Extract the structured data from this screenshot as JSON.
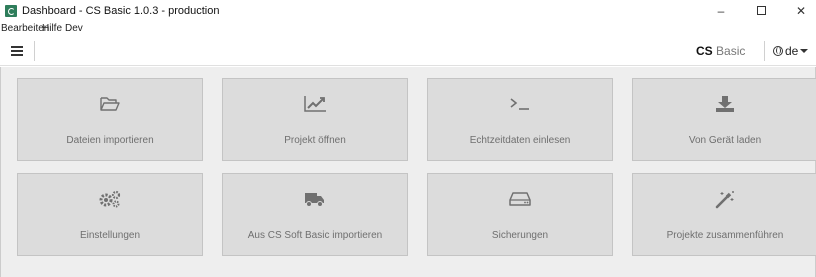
{
  "window": {
    "title": "Dashboard - CS Basic 1.0.3 - production",
    "minimize": "–",
    "close": "✕"
  },
  "menu": {
    "items": [
      "Bearbeiten",
      "Hilfe",
      "Dev"
    ]
  },
  "toolbar": {
    "brand_strong": "CS",
    "brand_light": "Basic",
    "language": "de"
  },
  "tiles": [
    {
      "label": "Dateien importieren",
      "icon": "folder-open-icon"
    },
    {
      "label": "Projekt öffnen",
      "icon": "line-chart-icon"
    },
    {
      "label": "Echtzeitdaten einlesen",
      "icon": "terminal-icon"
    },
    {
      "label": "Von Gerät laden",
      "icon": "download-icon"
    },
    {
      "label": "Einstellungen",
      "icon": "gears-icon"
    },
    {
      "label": "Aus CS Soft Basic importieren",
      "icon": "truck-icon"
    },
    {
      "label": "Sicherungen",
      "icon": "hard-drive-icon"
    },
    {
      "label": "Projekte zusammenführen",
      "icon": "magic-wand-icon"
    }
  ],
  "colors": {
    "tile_background": "#dcdcdc",
    "main_background": "#eeeeee",
    "icon": "#707070",
    "app_icon": "#2e7d5b"
  }
}
